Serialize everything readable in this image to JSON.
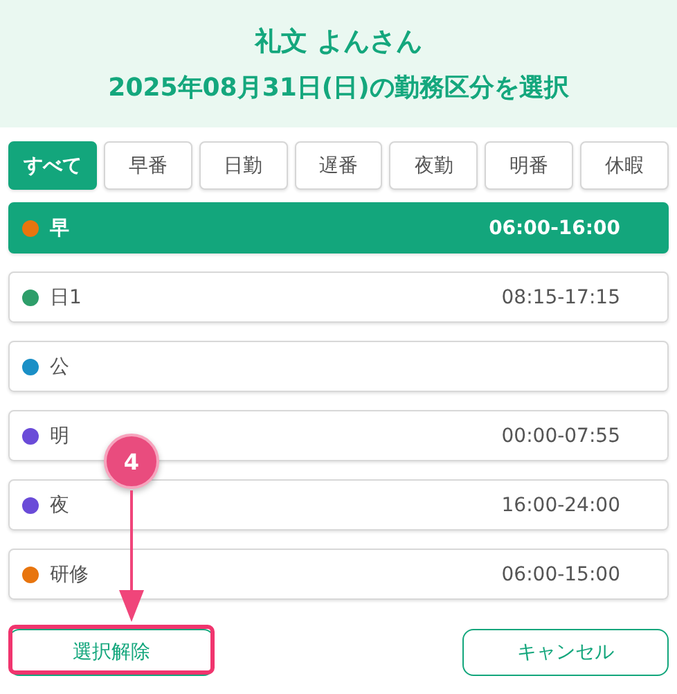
{
  "header": {
    "name": "礼文 よんさん",
    "subtitle": "2025年08月31日(日)の勤務区分を選択"
  },
  "filters": [
    {
      "label": "すべて",
      "selected": true
    },
    {
      "label": "早番",
      "selected": false
    },
    {
      "label": "日勤",
      "selected": false
    },
    {
      "label": "遅番",
      "selected": false
    },
    {
      "label": "夜勤",
      "selected": false
    },
    {
      "label": "明番",
      "selected": false
    },
    {
      "label": "休暇",
      "selected": false
    }
  ],
  "shifts": [
    {
      "name": "早",
      "time": "06:00-16:00",
      "color": "#e8750e",
      "selected": true
    },
    {
      "name": "日1",
      "time": "08:15-17:15",
      "color": "#2e9e6a",
      "selected": false
    },
    {
      "name": "公",
      "color": "#1a8fc6",
      "selected": false
    },
    {
      "name": "明",
      "time": "00:00-07:55",
      "color": "#6a4bd8",
      "selected": false
    },
    {
      "name": "夜",
      "time": "16:00-24:00",
      "color": "#6a4bd8",
      "selected": false
    },
    {
      "name": "研修",
      "time": "06:00-15:00",
      "color": "#e8750e",
      "selected": false
    }
  ],
  "buttons": {
    "clear": "選択解除",
    "cancel": "キャンセル"
  },
  "annotation": {
    "step": "4"
  }
}
